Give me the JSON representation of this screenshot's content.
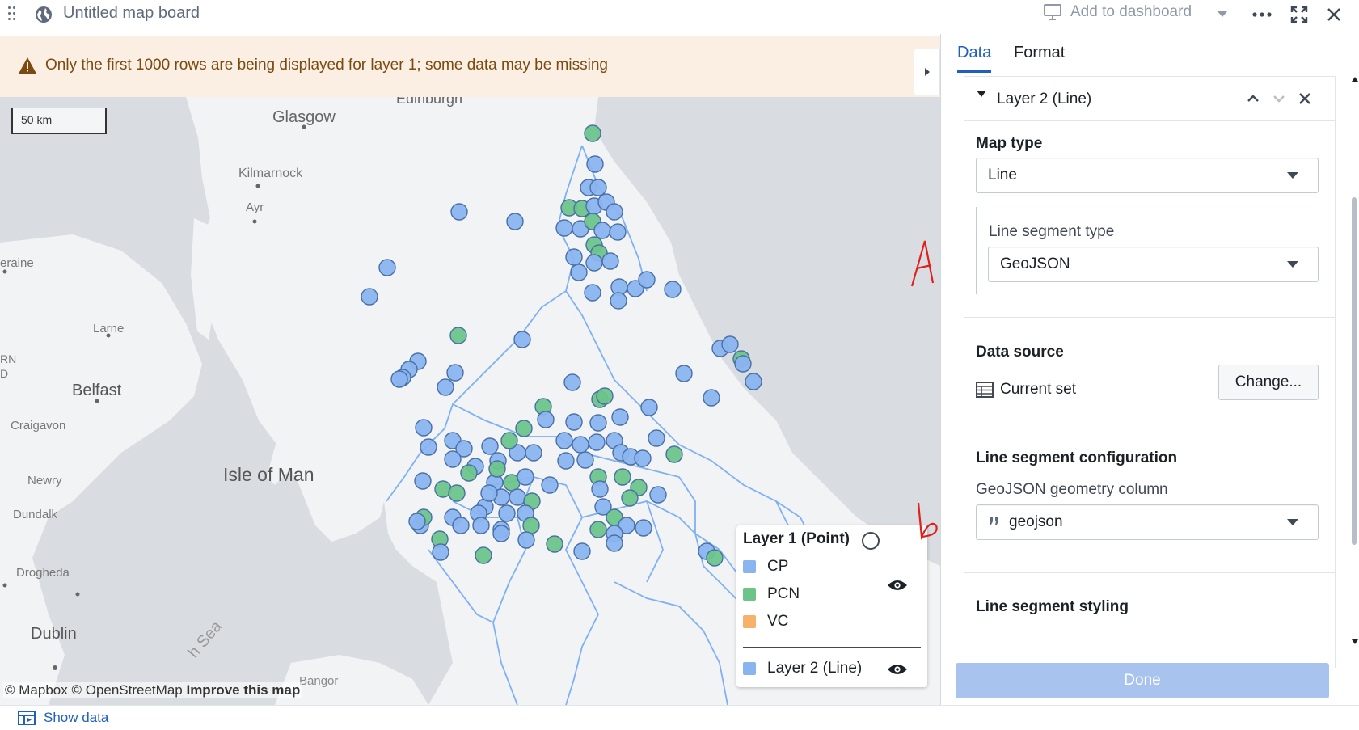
{
  "app": {
    "title": "Untitled map board",
    "add_to_dashboard": "Add to dashboard"
  },
  "warning": {
    "text": "Only the first 1000 rows are being displayed for layer 1; some data may be missing"
  },
  "map": {
    "scale_label": "50 km",
    "attribution": {
      "mapbox": "© Mapbox",
      "osm": "© OpenStreetMap",
      "improve": "Improve this map"
    },
    "place_labels": {
      "edinburgh": "Edinburgh",
      "glasgow": "Glasgow",
      "kilmarnock": "Kilmarnock",
      "ayr": "Ayr",
      "raine": "eraine",
      "larne": "Larne",
      "rn": "RN",
      "d": "D",
      "belfast": "Belfast",
      "craigavon": "Craigavon",
      "isle_of_man": "Isle of Man",
      "newry": "Newry",
      "dundalk": "Dundalk",
      "drogheda": "Drogheda",
      "dublin": "Dublin",
      "bangor": "Bangor",
      "sea": "h Sea"
    },
    "colors": {
      "cp": "#8ab4f0",
      "pcn": "#6cc48b",
      "vc": "#f6b26b",
      "boundary": "#7eb0f5",
      "water": "#d9dde2"
    }
  },
  "legend": {
    "layer1_title": "Layer 1 (Point)",
    "items": [
      {
        "label": "CP",
        "color": "#8ab4f0"
      },
      {
        "label": "PCN",
        "color": "#6cc48b"
      },
      {
        "label": "VC",
        "color": "#f6b26b"
      }
    ],
    "layer2_label": "Layer 2 (Line)"
  },
  "footer": {
    "show_data": "Show data"
  },
  "panel": {
    "tabs": [
      "Data",
      "Format"
    ],
    "layer_header": "Layer 2 (Line)",
    "map_type": {
      "title": "Map type",
      "value": "Line"
    },
    "segment_type": {
      "label": "Line segment type",
      "value": "GeoJSON",
      "annotation": "A"
    },
    "data_source": {
      "title": "Data source",
      "value": "Current set",
      "change_button": "Change..."
    },
    "segment_config": {
      "title": "Line segment configuration",
      "column_label": "GeoJSON geometry column",
      "column_value": "geojson",
      "annotation": "b"
    },
    "segment_styling": {
      "title": "Line segment styling"
    },
    "done_button": "Done"
  }
}
